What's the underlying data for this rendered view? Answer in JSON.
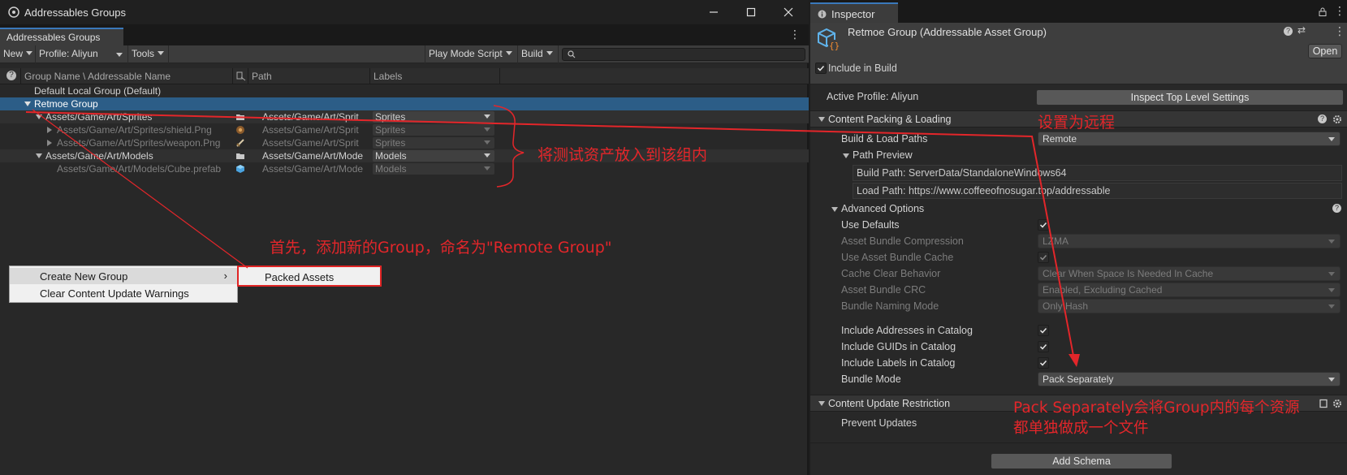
{
  "left_window": {
    "title": "Addressables Groups",
    "tab_label": "Addressables Groups",
    "toolbar": {
      "new_label": "New",
      "profile_label": "Profile: Aliyun",
      "tools_label": "Tools",
      "play_mode_label": "Play Mode Script",
      "build_label": "Build"
    },
    "columns": {
      "name": "Group Name \\ Addressable Name",
      "path": "Path",
      "labels": "Labels"
    },
    "rows": [
      {
        "name": "Default Local Group (Default)"
      },
      {
        "name": "Retmoe Group"
      },
      {
        "name": "Assets/Game/Art/Sprites",
        "path": "Assets/Game/Art/Sprit",
        "label": "Sprites"
      },
      {
        "name": "Assets/Game/Art/Sprites/shield.Png",
        "path": "Assets/Game/Art/Sprit",
        "label": "Sprites"
      },
      {
        "name": "Assets/Game/Art/Sprites/weapon.Png",
        "path": "Assets/Game/Art/Sprit",
        "label": "Sprites"
      },
      {
        "name": "Assets/Game/Art/Models",
        "path": "Assets/Game/Art/Mode",
        "label": "Models"
      },
      {
        "name": "Assets/Game/Art/Models/Cube.prefab",
        "path": "Assets/Game/Art/Mode",
        "label": "Models"
      }
    ],
    "context_menu": {
      "create_new_group": "Create New Group",
      "clear_warnings": "Clear Content Update Warnings",
      "submenu_packed_assets": "Packed Assets"
    }
  },
  "inspector": {
    "tab_label": "Inspector",
    "header_title": "Retmoe Group (Addressable Asset Group)",
    "open_button": "Open",
    "include_in_build": "Include in Build",
    "active_profile": "Active Profile: Aliyun",
    "inspect_top_level": "Inspect Top Level Settings",
    "content_packing_title": "Content Packing & Loading",
    "build_load_paths_label": "Build & Load Paths",
    "build_load_paths_value": "Remote",
    "path_preview_label": "Path Preview",
    "build_path": "Build Path: ServerData/StandaloneWindows64",
    "load_path": "Load Path: https://www.coffeeofnosugar.top/addressable",
    "advanced_options_label": "Advanced Options",
    "use_defaults_label": "Use Defaults",
    "compression_label": "Asset Bundle Compression",
    "compression_value": "LZMA",
    "use_cache_label": "Use Asset Bundle Cache",
    "cache_clear_label": "Cache Clear Behavior",
    "cache_clear_value": "Clear When Space Is Needed In Cache",
    "crc_label": "Asset Bundle CRC",
    "crc_value": "Enabled, Excluding Cached",
    "naming_label": "Bundle Naming Mode",
    "naming_value": "Only Hash",
    "include_addresses_label": "Include Addresses in Catalog",
    "include_guids_label": "Include GUIDs in Catalog",
    "include_labels_label": "Include Labels in Catalog",
    "bundle_mode_label": "Bundle Mode",
    "bundle_mode_value": "Pack Separately",
    "content_update_title": "Content Update Restriction",
    "prevent_updates_label": "Prevent Updates",
    "add_schema_button": "Add Schema"
  },
  "annotations": {
    "set_remote": "设置为远程",
    "put_assets": "将测试资产放入到该组内",
    "add_group": "首先，添加新的Group，命名为\"Remote Group\"",
    "pack_line1": "Pack Separately会将Group内的每个资源",
    "pack_line2": "都单独做成一个文件"
  },
  "colors": {
    "accent_blue": "#2c5d87",
    "annotation_red": "#e3262a",
    "panel_bg": "#282828"
  }
}
